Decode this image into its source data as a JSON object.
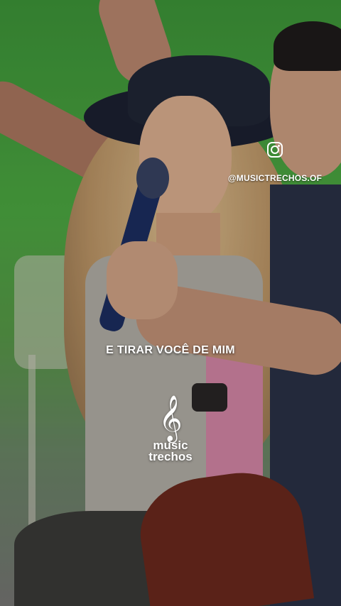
{
  "overlay": {
    "social_icon": "instagram-icon",
    "handle": "@MUSICTRECHOS.OF",
    "lyric": "E TIRAR VOCÊ DE MIM"
  },
  "logo": {
    "icon": "treble-clef-icon",
    "glyph": "𝄞",
    "line1": "music",
    "line2": "trechos"
  },
  "colors": {
    "background_green": "#4fae44",
    "text": "#ffffff"
  }
}
